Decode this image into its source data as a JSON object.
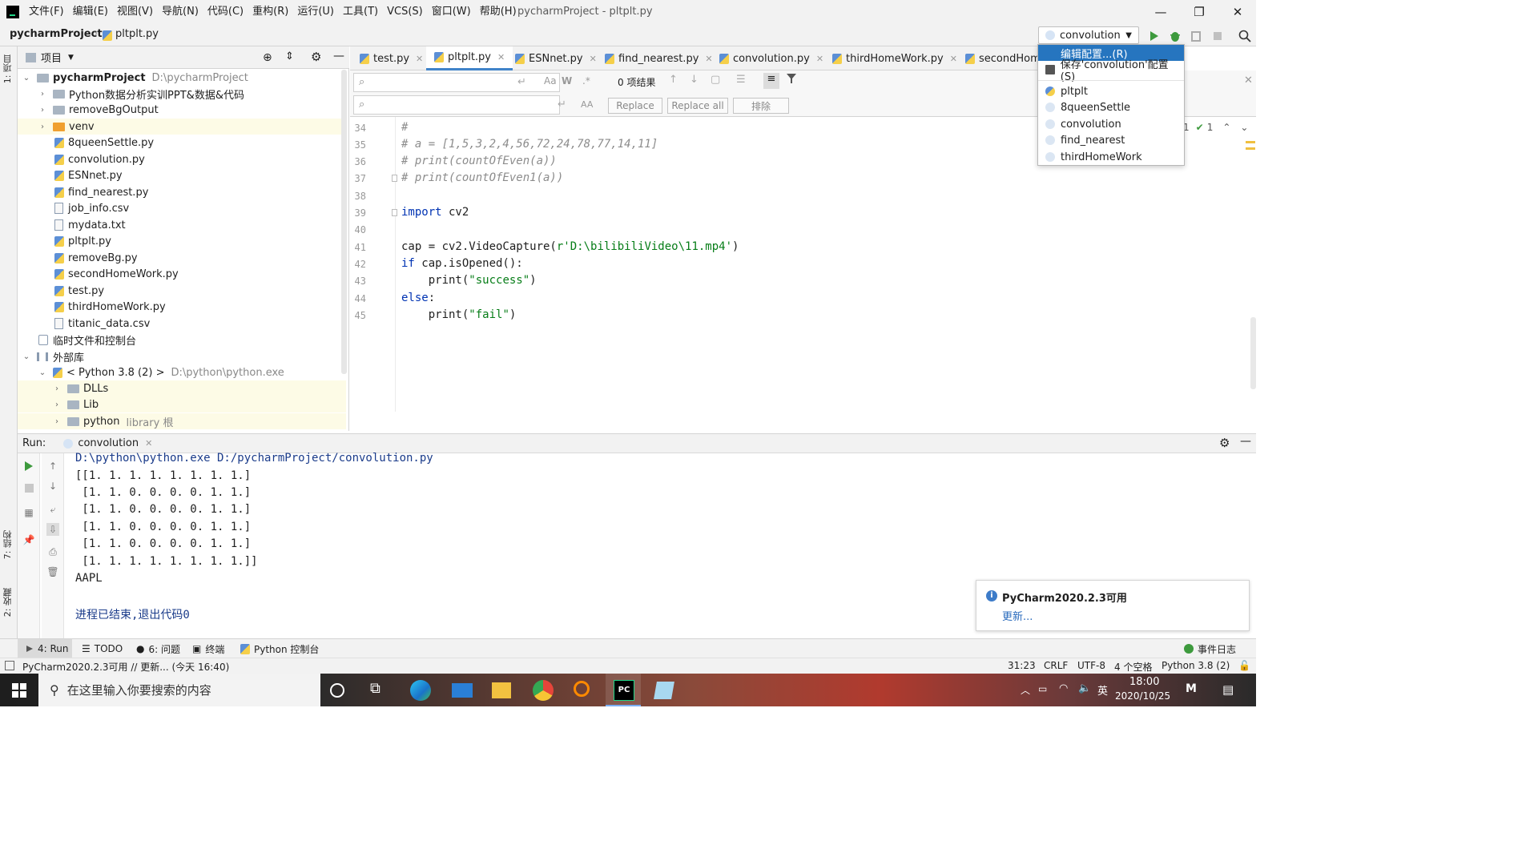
{
  "menu": [
    "文件(F)",
    "编辑(E)",
    "视图(V)",
    "导航(N)",
    "代码(C)",
    "重构(R)",
    "运行(U)",
    "工具(T)",
    "VCS(S)",
    "窗口(W)",
    "帮助(H)"
  ],
  "window_title": "pycharmProject - pltplt.py",
  "breadcrumb": {
    "project": "pycharmProject",
    "file": "pltplt.py"
  },
  "run_config": {
    "selected": "convolution"
  },
  "dropdown": {
    "items": [
      "编辑配置...(R)",
      "保存'convolution'配置 (S)"
    ],
    "configs": [
      "pltplt",
      "8queenSettle",
      "convolution",
      "find_nearest",
      "thirdHomeWork"
    ]
  },
  "project_panel": {
    "title": "项目",
    "tree": [
      {
        "label": "pycharmProject",
        "path": "D:\\pycharmProject"
      },
      {
        "label": "Python数据分析实训PPT&数据&代码"
      },
      {
        "label": "removeBgOutput"
      },
      {
        "label": "venv"
      },
      {
        "label": "8queenSettle.py"
      },
      {
        "label": "convolution.py"
      },
      {
        "label": "ESNnet.py"
      },
      {
        "label": "find_nearest.py"
      },
      {
        "label": "job_info.csv"
      },
      {
        "label": "mydata.txt"
      },
      {
        "label": "pltplt.py"
      },
      {
        "label": "removeBg.py"
      },
      {
        "label": "secondHomeWork.py"
      },
      {
        "label": "test.py"
      },
      {
        "label": "thirdHomeWork.py"
      },
      {
        "label": "titanic_data.csv"
      },
      {
        "label": "临时文件和控制台"
      },
      {
        "label": "外部库"
      },
      {
        "label": "< Python 3.8 (2) >",
        "path": "D:\\python\\python.exe"
      },
      {
        "label": "DLLs"
      },
      {
        "label": "Lib"
      },
      {
        "label": "python",
        "suffix": "library 根"
      }
    ]
  },
  "tabs": [
    "test.py",
    "pltplt.py",
    "ESNnet.py",
    "find_nearest.py",
    "convolution.py",
    "thirdHomeWork.py",
    "secondHom"
  ],
  "find": {
    "result": "0 项结果",
    "replace": "Replace",
    "replace_all": "Replace all",
    "exclude": "排除"
  },
  "editor": {
    "line_numbers": [
      "34",
      "35",
      "36",
      "37",
      "38",
      "39",
      "40",
      "41",
      "42",
      "43",
      "44",
      "45"
    ],
    "lines": [
      {
        "c": "#"
      },
      {
        "c": "# a = [1,5,3,2,4,56,72,24,78,77,14,11]"
      },
      {
        "c": "# print(countOfEven(a))"
      },
      {
        "c": "# print(countOfEven1(a))"
      },
      {
        "c": ""
      },
      {
        "kw": "import",
        "rest": " cv2"
      },
      {
        "c": ""
      },
      {
        "pre": "cap = cv2.VideoCapture(",
        "str": "r'D:\\bilibiliVideo\\11.mp4'",
        "post": ")"
      },
      {
        "kw": "if",
        "rest": " cap.isOpened():"
      },
      {
        "pre": "    print(",
        "str": "\"success\"",
        "post": ")"
      },
      {
        "kw": "else",
        "rest": ":"
      },
      {
        "pre": "    print(",
        "str": "\"fail\"",
        "post": ")"
      }
    ],
    "inspection": {
      "warnings": "1",
      "ok": "1"
    }
  },
  "run": {
    "label": "Run:",
    "tab": "convolution",
    "output": [
      "D:\\python\\python.exe D:/pycharmProject/convolution.py",
      "[[1. 1. 1. 1. 1. 1. 1. 1.]",
      " [1. 1. 0. 0. 0. 0. 1. 1.]",
      " [1. 1. 0. 0. 0. 0. 1. 1.]",
      " [1. 1. 0. 0. 0. 0. 1. 1.]",
      " [1. 1. 0. 0. 0. 0. 1. 1.]",
      " [1. 1. 1. 1. 1. 1. 1. 1.]]",
      "AAPL",
      "",
      "进程已结束,退出代码0"
    ]
  },
  "notification": {
    "title": "PyCharm2020.2.3可用",
    "link": "更新..."
  },
  "bottom_tabs": {
    "run": "4: Run",
    "todo": "TODO",
    "problems": "6: 问题",
    "terminal": "终端",
    "console": "Python 控制台",
    "event_log": "事件日志"
  },
  "status": {
    "message": "PyCharm2020.2.3可用 // 更新... (今天 16:40)",
    "position": "31:23",
    "line_sep": "CRLF",
    "encoding": "UTF-8",
    "indent": "4 个空格",
    "interpreter": "Python 3.8 (2)"
  },
  "left_stripe": {
    "project": "1: 项目",
    "structure": "7: 结构",
    "favorites": "2: 收藏"
  },
  "taskbar": {
    "search_placeholder": "在这里输入你要搜索的内容",
    "time": "18:00",
    "date": "2020/10/25",
    "lang": "英"
  },
  "colors": {
    "accent": "#2675bf",
    "keyword": "#0033b3",
    "string": "#067d17",
    "comment": "#8c8c8c",
    "run_green": "#3d9a3d"
  }
}
